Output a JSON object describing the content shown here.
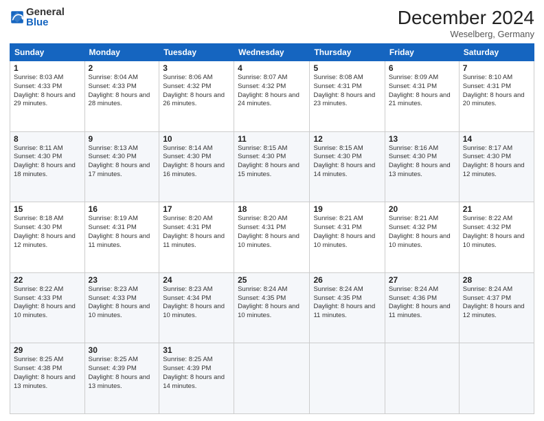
{
  "header": {
    "logo_general": "General",
    "logo_blue": "Blue",
    "title": "December 2024",
    "location": "Weselberg, Germany"
  },
  "days_of_week": [
    "Sunday",
    "Monday",
    "Tuesday",
    "Wednesday",
    "Thursday",
    "Friday",
    "Saturday"
  ],
  "weeks": [
    [
      {
        "day": "1",
        "sunrise": "Sunrise: 8:03 AM",
        "sunset": "Sunset: 4:33 PM",
        "daylight": "Daylight: 8 hours and 29 minutes."
      },
      {
        "day": "2",
        "sunrise": "Sunrise: 8:04 AM",
        "sunset": "Sunset: 4:33 PM",
        "daylight": "Daylight: 8 hours and 28 minutes."
      },
      {
        "day": "3",
        "sunrise": "Sunrise: 8:06 AM",
        "sunset": "Sunset: 4:32 PM",
        "daylight": "Daylight: 8 hours and 26 minutes."
      },
      {
        "day": "4",
        "sunrise": "Sunrise: 8:07 AM",
        "sunset": "Sunset: 4:32 PM",
        "daylight": "Daylight: 8 hours and 24 minutes."
      },
      {
        "day": "5",
        "sunrise": "Sunrise: 8:08 AM",
        "sunset": "Sunset: 4:31 PM",
        "daylight": "Daylight: 8 hours and 23 minutes."
      },
      {
        "day": "6",
        "sunrise": "Sunrise: 8:09 AM",
        "sunset": "Sunset: 4:31 PM",
        "daylight": "Daylight: 8 hours and 21 minutes."
      },
      {
        "day": "7",
        "sunrise": "Sunrise: 8:10 AM",
        "sunset": "Sunset: 4:31 PM",
        "daylight": "Daylight: 8 hours and 20 minutes."
      }
    ],
    [
      {
        "day": "8",
        "sunrise": "Sunrise: 8:11 AM",
        "sunset": "Sunset: 4:30 PM",
        "daylight": "Daylight: 8 hours and 18 minutes."
      },
      {
        "day": "9",
        "sunrise": "Sunrise: 8:13 AM",
        "sunset": "Sunset: 4:30 PM",
        "daylight": "Daylight: 8 hours and 17 minutes."
      },
      {
        "day": "10",
        "sunrise": "Sunrise: 8:14 AM",
        "sunset": "Sunset: 4:30 PM",
        "daylight": "Daylight: 8 hours and 16 minutes."
      },
      {
        "day": "11",
        "sunrise": "Sunrise: 8:15 AM",
        "sunset": "Sunset: 4:30 PM",
        "daylight": "Daylight: 8 hours and 15 minutes."
      },
      {
        "day": "12",
        "sunrise": "Sunrise: 8:15 AM",
        "sunset": "Sunset: 4:30 PM",
        "daylight": "Daylight: 8 hours and 14 minutes."
      },
      {
        "day": "13",
        "sunrise": "Sunrise: 8:16 AM",
        "sunset": "Sunset: 4:30 PM",
        "daylight": "Daylight: 8 hours and 13 minutes."
      },
      {
        "day": "14",
        "sunrise": "Sunrise: 8:17 AM",
        "sunset": "Sunset: 4:30 PM",
        "daylight": "Daylight: 8 hours and 12 minutes."
      }
    ],
    [
      {
        "day": "15",
        "sunrise": "Sunrise: 8:18 AM",
        "sunset": "Sunset: 4:30 PM",
        "daylight": "Daylight: 8 hours and 12 minutes."
      },
      {
        "day": "16",
        "sunrise": "Sunrise: 8:19 AM",
        "sunset": "Sunset: 4:31 PM",
        "daylight": "Daylight: 8 hours and 11 minutes."
      },
      {
        "day": "17",
        "sunrise": "Sunrise: 8:20 AM",
        "sunset": "Sunset: 4:31 PM",
        "daylight": "Daylight: 8 hours and 11 minutes."
      },
      {
        "day": "18",
        "sunrise": "Sunrise: 8:20 AM",
        "sunset": "Sunset: 4:31 PM",
        "daylight": "Daylight: 8 hours and 10 minutes."
      },
      {
        "day": "19",
        "sunrise": "Sunrise: 8:21 AM",
        "sunset": "Sunset: 4:31 PM",
        "daylight": "Daylight: 8 hours and 10 minutes."
      },
      {
        "day": "20",
        "sunrise": "Sunrise: 8:21 AM",
        "sunset": "Sunset: 4:32 PM",
        "daylight": "Daylight: 8 hours and 10 minutes."
      },
      {
        "day": "21",
        "sunrise": "Sunrise: 8:22 AM",
        "sunset": "Sunset: 4:32 PM",
        "daylight": "Daylight: 8 hours and 10 minutes."
      }
    ],
    [
      {
        "day": "22",
        "sunrise": "Sunrise: 8:22 AM",
        "sunset": "Sunset: 4:33 PM",
        "daylight": "Daylight: 8 hours and 10 minutes."
      },
      {
        "day": "23",
        "sunrise": "Sunrise: 8:23 AM",
        "sunset": "Sunset: 4:33 PM",
        "daylight": "Daylight: 8 hours and 10 minutes."
      },
      {
        "day": "24",
        "sunrise": "Sunrise: 8:23 AM",
        "sunset": "Sunset: 4:34 PM",
        "daylight": "Daylight: 8 hours and 10 minutes."
      },
      {
        "day": "25",
        "sunrise": "Sunrise: 8:24 AM",
        "sunset": "Sunset: 4:35 PM",
        "daylight": "Daylight: 8 hours and 10 minutes."
      },
      {
        "day": "26",
        "sunrise": "Sunrise: 8:24 AM",
        "sunset": "Sunset: 4:35 PM",
        "daylight": "Daylight: 8 hours and 11 minutes."
      },
      {
        "day": "27",
        "sunrise": "Sunrise: 8:24 AM",
        "sunset": "Sunset: 4:36 PM",
        "daylight": "Daylight: 8 hours and 11 minutes."
      },
      {
        "day": "28",
        "sunrise": "Sunrise: 8:24 AM",
        "sunset": "Sunset: 4:37 PM",
        "daylight": "Daylight: 8 hours and 12 minutes."
      }
    ],
    [
      {
        "day": "29",
        "sunrise": "Sunrise: 8:25 AM",
        "sunset": "Sunset: 4:38 PM",
        "daylight": "Daylight: 8 hours and 13 minutes."
      },
      {
        "day": "30",
        "sunrise": "Sunrise: 8:25 AM",
        "sunset": "Sunset: 4:39 PM",
        "daylight": "Daylight: 8 hours and 13 minutes."
      },
      {
        "day": "31",
        "sunrise": "Sunrise: 8:25 AM",
        "sunset": "Sunset: 4:39 PM",
        "daylight": "Daylight: 8 hours and 14 minutes."
      },
      null,
      null,
      null,
      null
    ]
  ]
}
